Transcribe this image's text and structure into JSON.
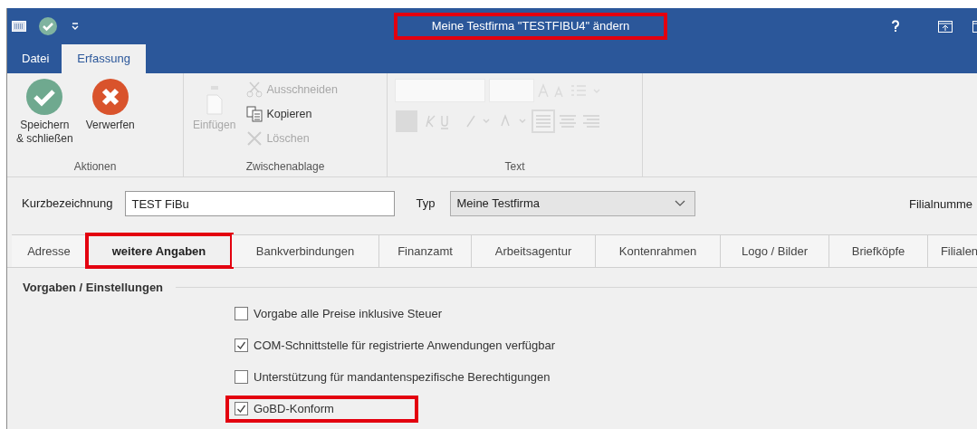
{
  "window": {
    "title": "Meine Testfirma \"TESTFIBU4\" ändern",
    "title_highlighted": true
  },
  "ribbon_tabs": [
    {
      "label": "Datei",
      "selected": false
    },
    {
      "label": "Erfassung",
      "selected": true
    }
  ],
  "ribbon_groups": [
    {
      "label": "Aktionen",
      "items": [
        {
          "kind": "save",
          "label": "Speichern\n& schließen",
          "disabled": false
        },
        {
          "kind": "discard",
          "label": "Verwerfen",
          "disabled": false
        }
      ]
    },
    {
      "label": "Zwischenablage",
      "items": [
        {
          "kind": "paste",
          "label": "Einfügen",
          "disabled": true
        },
        {
          "kind": "cut",
          "label": "Ausschneiden",
          "disabled": true
        },
        {
          "kind": "copy",
          "label": "Kopieren",
          "disabled": false
        },
        {
          "kind": "delete",
          "label": "Löschen",
          "disabled": true
        }
      ]
    },
    {
      "label": "Text",
      "items": [
        {
          "kind": "format",
          "disabled": true
        }
      ]
    }
  ],
  "form": {
    "short_label": "Kurzbezeichnung",
    "short_value": "TEST FiBu",
    "type_label": "Typ",
    "type_value": "Meine Testfirma",
    "branch_label": "Filialnumme"
  },
  "tabs": [
    {
      "label": "Adresse",
      "selected": false,
      "highlighted": false
    },
    {
      "label": "weitere Angaben",
      "selected": true,
      "highlighted": true
    },
    {
      "label": "Bankverbindungen",
      "selected": false,
      "highlighted": false
    },
    {
      "label": "Finanzamt",
      "selected": false,
      "highlighted": false
    },
    {
      "label": "Arbeitsagentur",
      "selected": false,
      "highlighted": false
    },
    {
      "label": "Kontenrahmen",
      "selected": false,
      "highlighted": false
    },
    {
      "label": "Logo / Bilder",
      "selected": false,
      "highlighted": false
    },
    {
      "label": "Briefköpfe",
      "selected": false,
      "highlighted": false
    },
    {
      "label": "Filialen",
      "selected": false,
      "highlighted": false
    }
  ],
  "section": {
    "title": "Vorgaben / Einstellungen",
    "options": [
      {
        "label": "Vorgabe alle Preise inklusive Steuer",
        "checked": false,
        "highlighted": false
      },
      {
        "label": "COM-Schnittstelle für registrierte Anwendungen verfügbar",
        "checked": true,
        "highlighted": false
      },
      {
        "label": "Unterstützung für mandantenspezifische Berechtigungen",
        "checked": false,
        "highlighted": false
      },
      {
        "label": "GoBD-Konform",
        "checked": true,
        "highlighted": true
      }
    ]
  }
}
